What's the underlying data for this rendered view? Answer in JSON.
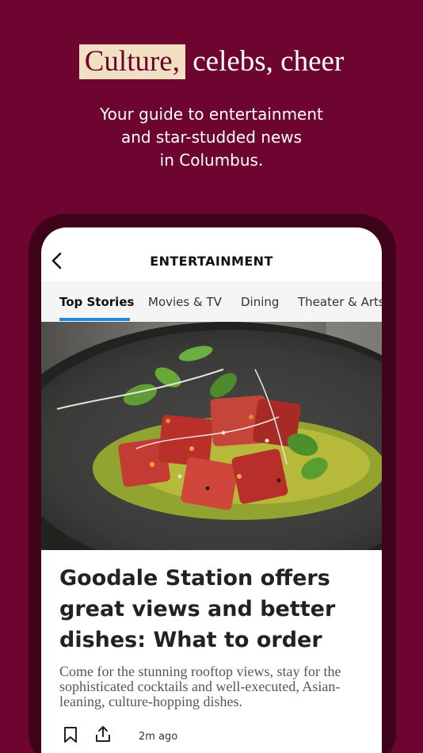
{
  "promo": {
    "headline_highlight": "Culture,",
    "headline_rest": " celebs, cheer",
    "subhead_lines": [
      "Your guide to entertainment",
      "and star-studded news",
      "in Columbus."
    ]
  },
  "app": {
    "section_title": "ENTERTAINMENT",
    "back_icon": "chevron-left-icon",
    "tabs": [
      {
        "label": "Top Stories",
        "active": true
      },
      {
        "label": "Movies & TV",
        "active": false
      },
      {
        "label": "Dining",
        "active": false
      },
      {
        "label": "Theater & Arts",
        "active": false
      }
    ],
    "article": {
      "image": "plated-tuna-dish-photo",
      "title": "Goodale Station offers great views and better dishes: What to order",
      "summary": "Come for the stunning rooftop views, stay for the sophisticated cocktails and well-executed, Asian-leaning, culture-hopping dishes.",
      "timestamp": "2m ago",
      "bookmark_icon": "bookmark-icon",
      "share_icon": "share-icon"
    }
  },
  "colors": {
    "background": "#6e0530",
    "highlight": "#f1e0c2",
    "tab_accent": "#1c8ae0"
  }
}
